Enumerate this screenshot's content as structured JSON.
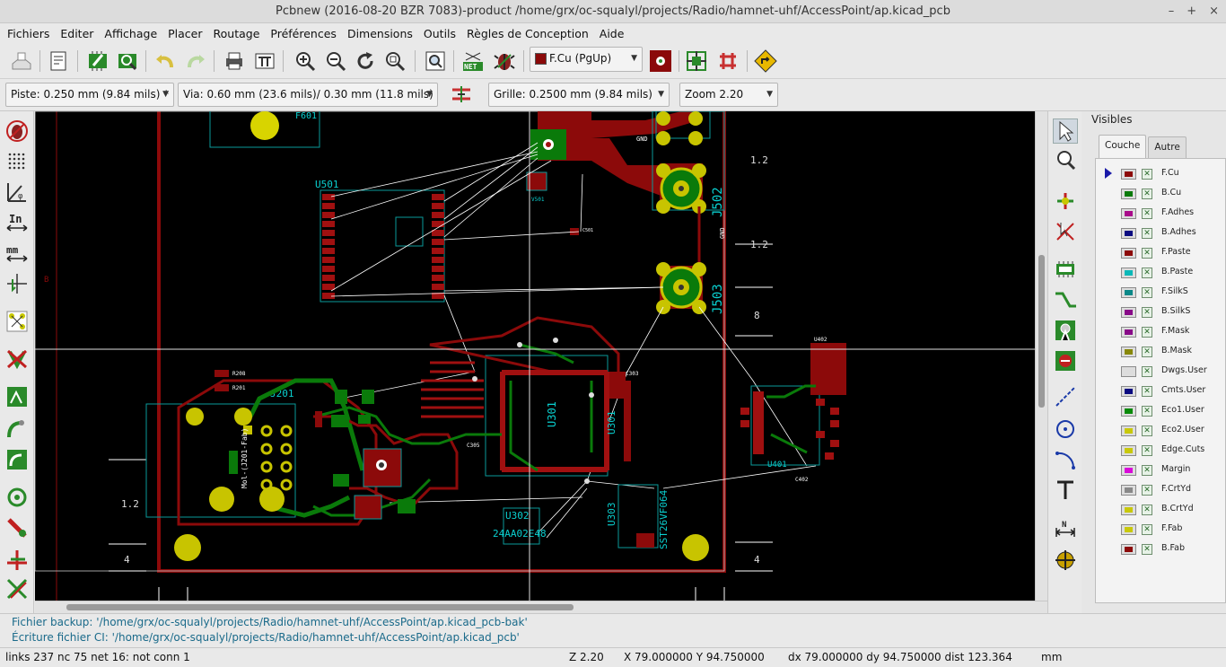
{
  "window": {
    "title": "Pcbnew (2016-08-20 BZR 7083)-product /home/grx/oc-squalyl/projects/Radio/hamnet-uhf/AccessPoint/ap.kicad_pcb",
    "controls": {
      "minimize": "–",
      "restore": "+",
      "close": "×"
    }
  },
  "menu": {
    "items": [
      "Fichiers",
      "Editer",
      "Affichage",
      "Placer",
      "Routage",
      "Préférences",
      "Dimensions",
      "Outils",
      "Règles de Conception",
      "Aide"
    ]
  },
  "toolbar": {
    "layer_select": "F.Cu (PgUp)",
    "layer_color": "#8b0a0a",
    "icons": [
      "new-board-icon",
      "page-settings-icon",
      "module-editor-icon",
      "module-viewer-icon",
      "undo-icon",
      "redo-icon",
      "print-icon",
      "plot-icon",
      "zoom-in-icon",
      "zoom-out-icon",
      "redraw-icon",
      "zoom-fit-icon",
      "find-icon",
      "netlist-icon",
      "drc-icon",
      "layer-pair-icon",
      "auto-place-icon",
      "auto-route-icon",
      "scripting-icon"
    ]
  },
  "toolbar2": {
    "track_width": "Piste: 0.250 mm (9.84 mils) *",
    "via_size": "Via: 0.60 mm (23.6 mils)/ 0.30 mm (11.8 mils) *",
    "grid": "Grille: 0.2500 mm (9.84 mils)",
    "zoom": "Zoom 2.20"
  },
  "canvas": {
    "labels": {
      "u501": "U501",
      "j201": "J201",
      "u301": "U301",
      "u301b": "U301",
      "u302": "U302",
      "u302_part": "24AA02E48",
      "j502": "J502",
      "j503": "J503",
      "u401": "U401",
      "c402": "C402",
      "u303": "U303",
      "u303_part": "SST26VF064",
      "j201_part": "Mol-(J201-Fab)",
      "f601": "F601",
      "dim_12a": "1.2",
      "dim_12b": "1.2",
      "dim_8": "8",
      "dim_12c": "1.2",
      "dim_4a": "4",
      "dim_4b": "4",
      "gnd_a": "GND",
      "gnd_b": "GND",
      "u402": "U402",
      "c305": "C305",
      "c303": "C303",
      "r208": "R208",
      "r201": "R201",
      "c501": "C501",
      "v501": "V501",
      "gnd_j": "GND",
      "side_b": "B"
    },
    "colors": {
      "fcu": "#8c0a0a",
      "bcu": "#0a7a0a",
      "silk": "#00d0d0",
      "pad": "#d8d400",
      "edge": "#c8c8c8",
      "ratsnest": "#ffffff"
    }
  },
  "right_toolbar": {
    "icons": [
      "select-arrow-icon",
      "highlight-net-icon",
      "local-ratsnest-icon",
      "module-place-icon",
      "footprint-icon",
      "track-route-icon",
      "via-icon",
      "keepout-icon",
      "graphic-line-icon",
      "circle-icon",
      "arc-icon",
      "text-icon",
      "dimension-icon",
      "target-icon"
    ]
  },
  "left_toolbar": {
    "icons": [
      "drc-off-icon",
      "grid-icon",
      "polar-coords-icon",
      "units-inch-icon",
      "units-mm-icon",
      "cursor-shape-icon",
      "ratsnest-icon",
      "local-ratsnest-icon",
      "zone-fill-icon",
      "pad-sketch-icon",
      "via-sketch-icon",
      "track-sketch-icon",
      "hc-mode-icon",
      "layers-manager-icon",
      "microwave-icon"
    ]
  },
  "layers_panel": {
    "title": "Visibles",
    "tabs": [
      "Couche",
      "Autre"
    ],
    "active_tab": "Couche",
    "layers": [
      {
        "name": "F.Cu",
        "color": "#8c0a0a",
        "active": true
      },
      {
        "name": "B.Cu",
        "color": "#0a7a0a"
      },
      {
        "name": "F.Adhes",
        "color": "#a80a8a"
      },
      {
        "name": "B.Adhes",
        "color": "#0a0a80"
      },
      {
        "name": "F.Paste",
        "color": "#8c0a0a"
      },
      {
        "name": "B.Paste",
        "color": "#0ab8b8"
      },
      {
        "name": "F.SilkS",
        "color": "#0a8888"
      },
      {
        "name": "B.SilkS",
        "color": "#880a88"
      },
      {
        "name": "F.Mask",
        "color": "#880a88"
      },
      {
        "name": "B.Mask",
        "color": "#88880a"
      },
      {
        "name": "Dwgs.User",
        "color": "#dcdcdc"
      },
      {
        "name": "Cmts.User",
        "color": "#0a0a80"
      },
      {
        "name": "Eco1.User",
        "color": "#0a8a0a"
      },
      {
        "name": "Eco2.User",
        "color": "#c8c80a"
      },
      {
        "name": "Edge.Cuts",
        "color": "#c8c80a"
      },
      {
        "name": "Margin",
        "color": "#d80ad8"
      },
      {
        "name": "F.CrtYd",
        "color": "#888888"
      },
      {
        "name": "B.CrtYd",
        "color": "#c8c80a"
      },
      {
        "name": "F.Fab",
        "color": "#c8c80a"
      },
      {
        "name": "B.Fab",
        "color": "#8c0a0a"
      }
    ]
  },
  "messages": {
    "backup": "Fichier backup: '/home/grx/oc-squalyl/projects/Radio/hamnet-uhf/AccessPoint/ap.kicad_pcb-bak'",
    "write": "Écriture fichier CI: '/home/grx/oc-squalyl/projects/Radio/hamnet-uhf/AccessPoint/ap.kicad_pcb'"
  },
  "status": {
    "links": "links 237 nc 75  net 16: not conn 1",
    "zoom": "Z 2.20",
    "xy": "X 79.000000  Y 94.750000",
    "dxy": "dx 79.000000  dy 94.750000  dist 123.364",
    "units": "mm"
  }
}
